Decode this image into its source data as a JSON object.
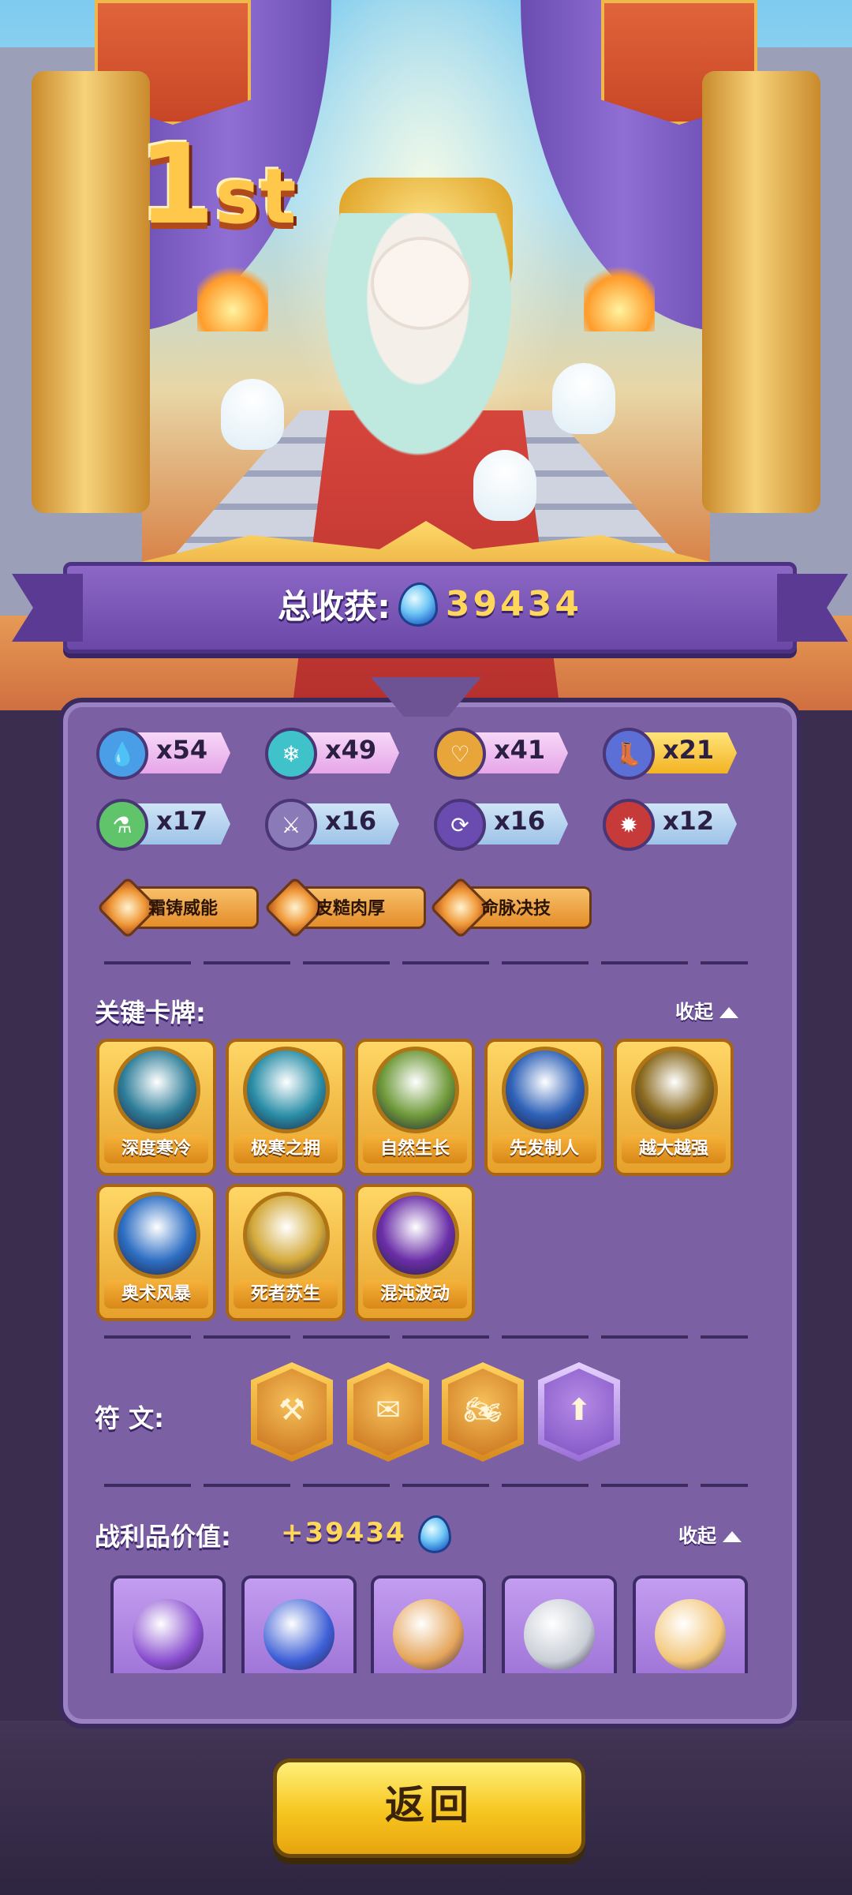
{
  "rank": {
    "number": "1",
    "suffix": "st"
  },
  "total": {
    "label": "总收获:",
    "value": "39434"
  },
  "resources": [
    {
      "icon": "water-drop-icon",
      "glyph": "💧",
      "color": "#4a9ee8",
      "style": "pink",
      "count": "x54"
    },
    {
      "icon": "snowflake-icon",
      "glyph": "❄",
      "color": "#3fc2c9",
      "style": "pink",
      "count": "x49"
    },
    {
      "icon": "heart-icon",
      "glyph": "♡",
      "color": "#e7a53a",
      "style": "pink",
      "count": "x41"
    },
    {
      "icon": "boot-icon",
      "glyph": "👢",
      "color": "#5b6fd6",
      "style": "gold",
      "count": "x21"
    },
    {
      "icon": "potion-icon",
      "glyph": "⚗",
      "color": "#5fc46a",
      "style": "blue",
      "count": "x17"
    },
    {
      "icon": "sword-icon",
      "glyph": "⚔",
      "color": "#8a7bb8",
      "style": "blue",
      "count": "x16"
    },
    {
      "icon": "cycle-icon",
      "glyph": "⟳",
      "color": "#6a4bb0",
      "style": "blue",
      "count": "x16"
    },
    {
      "icon": "flame-crest-icon",
      "glyph": "✹",
      "color": "#c63a3a",
      "style": "blue",
      "count": "x12"
    }
  ],
  "skills": [
    {
      "label": "霜铸威能"
    },
    {
      "label": "皮糙肉厚"
    },
    {
      "label": "命脉决技"
    }
  ],
  "key_cards": {
    "title": "关键卡牌:",
    "collapse_label": "收起",
    "cards": [
      {
        "name": "深度寒冷",
        "icon": "thermometer-icon",
        "color": "#2f7f9a"
      },
      {
        "name": "极寒之拥",
        "icon": "ice-shield-icon",
        "color": "#2b8fa8"
      },
      {
        "name": "自然生长",
        "icon": "vine-icon",
        "color": "#6f9a3a"
      },
      {
        "name": "先发制人",
        "icon": "blue-beast-icon",
        "color": "#2f62b8"
      },
      {
        "name": "越大越强",
        "icon": "bull-icon",
        "color": "#8a6a1e"
      },
      {
        "name": "奥术风暴",
        "icon": "arcane-vortex-icon",
        "color": "#2e6fc4"
      },
      {
        "name": "死者苏生",
        "icon": "winged-heart-icon",
        "color": "#d3a93a"
      },
      {
        "name": "混沌波动",
        "icon": "chaos-die-icon",
        "color": "#6b2fa8"
      }
    ]
  },
  "runes": {
    "title": "符 文:",
    "items": [
      {
        "icon": "anvil-rune-icon",
        "glyph": "⚒",
        "style": "gold"
      },
      {
        "icon": "envelope-rune-icon",
        "glyph": "✉",
        "style": "gold"
      },
      {
        "icon": "motorcycle-rune-icon",
        "glyph": "🏍",
        "style": "gold"
      },
      {
        "icon": "card-upgrade-rune-icon",
        "glyph": "⬆",
        "style": "purple"
      }
    ]
  },
  "loot": {
    "title": "战利品价值:",
    "value": "+39434",
    "collapse_label": "收起",
    "items": [
      {
        "icon": "candy-icon",
        "color": "#8a4fd0"
      },
      {
        "icon": "sapphire-icon",
        "color": "#3d5fd6"
      },
      {
        "icon": "teddy-bear-icon",
        "color": "#e5a55a"
      },
      {
        "icon": "key-icon",
        "color": "#c9ced6"
      },
      {
        "icon": "birthday-cake-icon",
        "color": "#f3c77a"
      }
    ]
  },
  "return_label": "返回"
}
